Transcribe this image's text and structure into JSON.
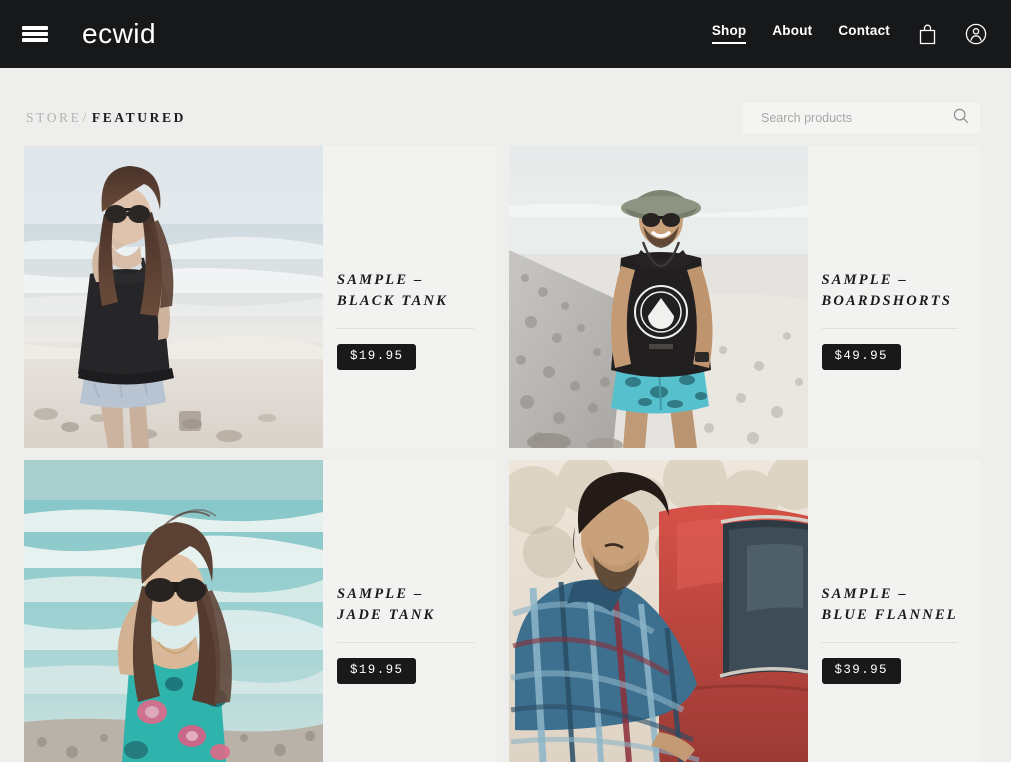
{
  "header": {
    "menu_icon": "hamburger-menu-icon",
    "brand": "ecwid",
    "nav": [
      {
        "label": "Shop",
        "active": true
      },
      {
        "label": "About",
        "active": false
      },
      {
        "label": "Contact",
        "active": false
      }
    ],
    "cart_icon": "shopping-bag-icon",
    "account_icon": "user-account-icon",
    "background": "#17181a",
    "text_color": "#ffffff"
  },
  "breadcrumb": {
    "root": "STORE",
    "separator": "/",
    "current": "FEATURED"
  },
  "search": {
    "placeholder": "Search products",
    "value": "",
    "icon": "search-icon"
  },
  "products": [
    {
      "title": "SAMPLE – BLACK TANK",
      "price": "$19.95",
      "image_alt": "woman-in-black-tank-on-beach"
    },
    {
      "title": "SAMPLE – BOARDSHORTS",
      "price": "$49.95",
      "image_alt": "man-in-bucket-hat-black-tank-and-boardshorts-on-rocky-beach"
    },
    {
      "title": "SAMPLE – JADE TANK",
      "price": "$19.95",
      "image_alt": "woman-in-jade-floral-tank-with-sunglasses-at-ocean"
    },
    {
      "title": "SAMPLE – BLUE FLANNEL",
      "price": "$39.95",
      "image_alt": "man-in-blue-plaid-flannel-beside-red-truck"
    }
  ],
  "colors": {
    "page_background": "#eeeeed",
    "card_background": "#f2f2f1",
    "accent_dark": "#191919",
    "muted_text": "#b6b4b2"
  }
}
